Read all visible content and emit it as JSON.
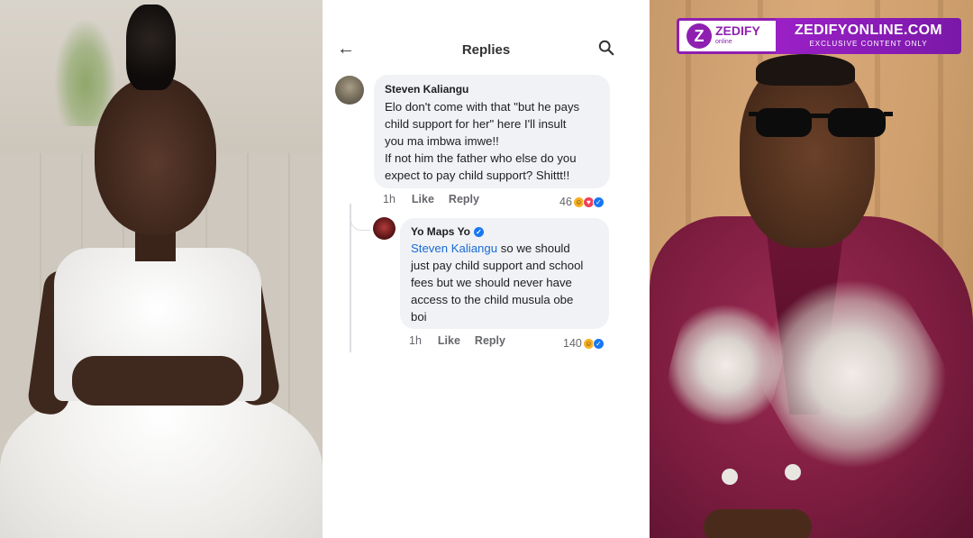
{
  "header": {
    "title": "Replies"
  },
  "comments": [
    {
      "author": "Steven Kaliangu",
      "lines": [
        "Elo don't come with that \"but he pays",
        "child support for her\" here I'll insult",
        "you ma imbwa imwe!!",
        "If not him the father who else do you",
        "expect to pay child support? Shittt!!"
      ],
      "time": "1h",
      "like_label": "Like",
      "reply_label": "Reply",
      "reaction_count": "46",
      "reactions": [
        "haha",
        "love",
        "like"
      ]
    },
    {
      "author": "Yo Maps Yo",
      "verified": true,
      "mention": "Steven Kaliangu",
      "lines": [
        " so we should",
        "just pay child support and school",
        "fees but we should never have",
        "access to the child musula obe",
        "boi"
      ],
      "time": "1h",
      "like_label": "Like",
      "reply_label": "Reply",
      "reaction_count": "140",
      "reactions": [
        "haha",
        "like"
      ]
    }
  ],
  "watermark": {
    "logo_letter": "Z",
    "logo_text": "ZEDIFY",
    "logo_sub": "online",
    "title": "ZEDIFYONLINE.COM",
    "subtitle": "EXCLUSIVE CONTENT ONLY"
  },
  "colors": {
    "mention": "#1a6ad7",
    "bubble": "#f0f2f5",
    "watermark_purple": "#8f1fb0",
    "jacket": "#8e2249"
  },
  "icons": {
    "back": "arrow-left-icon",
    "search": "search-icon",
    "verified": "verified-badge-icon"
  }
}
